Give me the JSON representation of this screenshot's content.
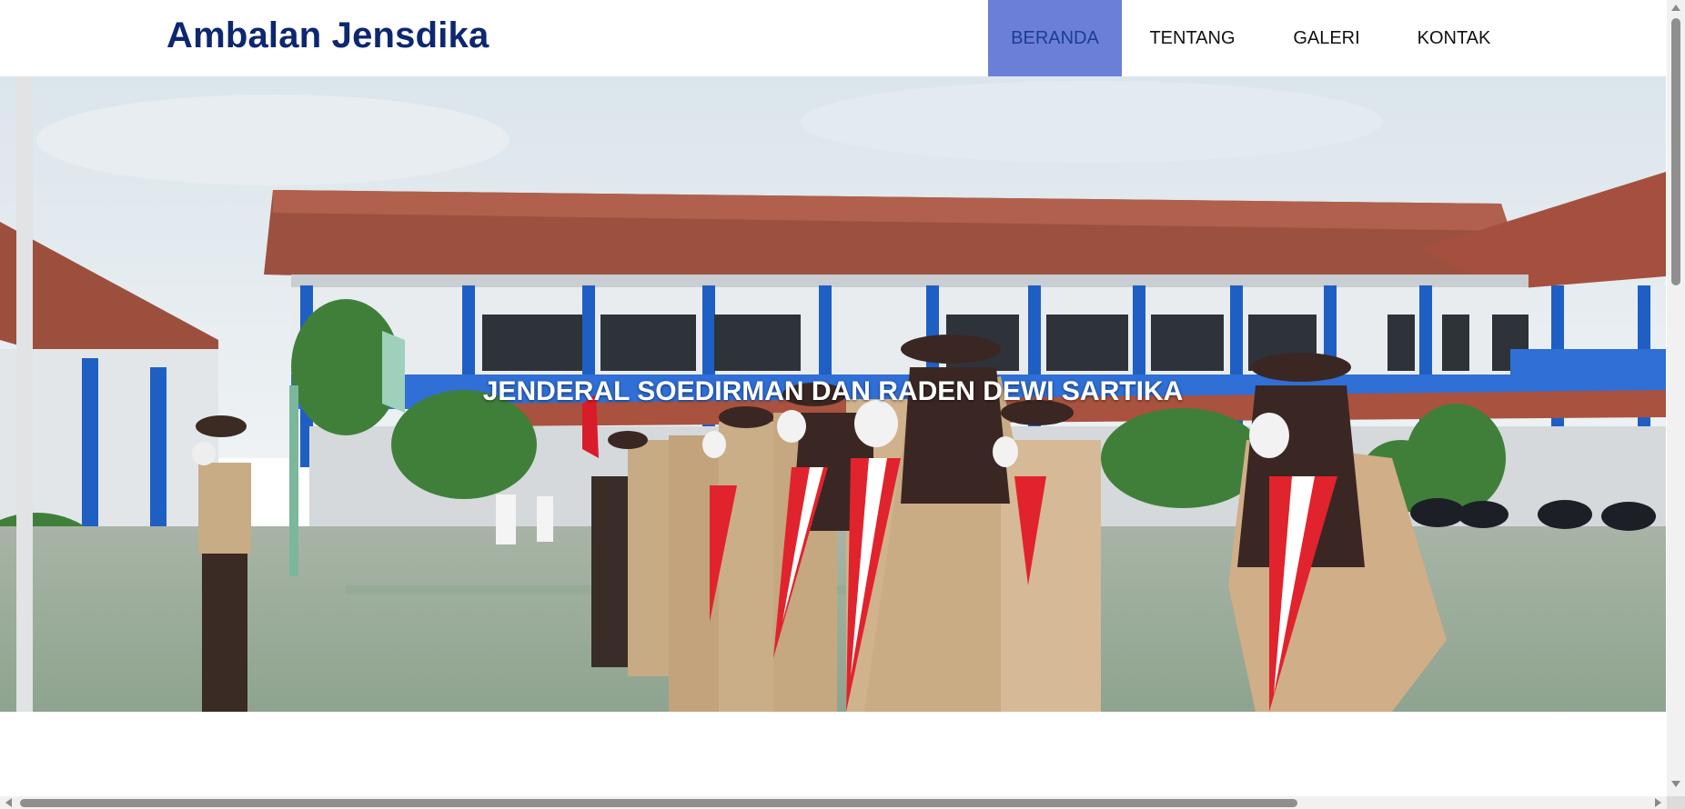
{
  "header": {
    "brand": "Ambalan Jensdika",
    "nav": [
      {
        "label": "BERANDA",
        "active": true
      },
      {
        "label": "TENTANG",
        "active": false
      },
      {
        "label": "GALERI",
        "active": false
      },
      {
        "label": "KONTAK",
        "active": false
      }
    ]
  },
  "hero": {
    "caption": "JENDERAL SOEDIRMAN DAN RADEN DEWI SARTIKA"
  },
  "colors": {
    "brand": "#0d2770",
    "nav_active_bg": "#6c7fd8",
    "nav_active_text": "#1b3d94"
  }
}
